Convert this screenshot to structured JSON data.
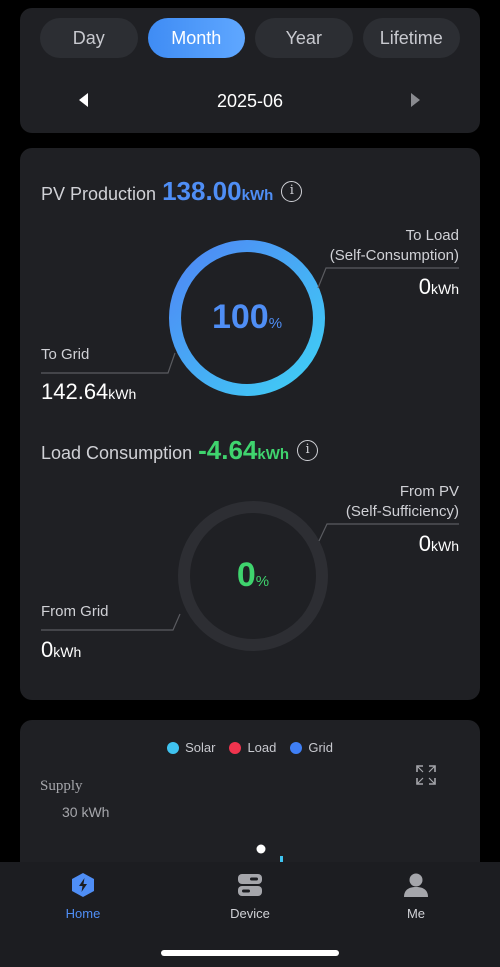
{
  "period_tabs": [
    {
      "label": "Day",
      "active": false
    },
    {
      "label": "Month",
      "active": true
    },
    {
      "label": "Year",
      "active": false
    },
    {
      "label": "Lifetime",
      "active": false
    }
  ],
  "date": {
    "label": "2025-06",
    "prev_icon": "chevron-left-icon",
    "next_icon": "chevron-right-icon"
  },
  "pv": {
    "title": "PV Production",
    "value": "138.00",
    "unit": "kWh",
    "percent": "100",
    "percent_unit": "%",
    "ring_fill": 1.0,
    "to_load_label_line1": "To Load",
    "to_load_label_line2": "(Self-Consumption)",
    "to_load_value": "0",
    "to_load_unit": "kWh",
    "to_grid_label": "To Grid",
    "to_grid_value": "142.64",
    "to_grid_unit": "kWh"
  },
  "load": {
    "title": "Load Consumption",
    "value": "-4.64",
    "unit": "kWh",
    "percent": "0",
    "percent_unit": "%",
    "ring_fill": 0.0,
    "from_pv_label_line1": "From PV",
    "from_pv_label_line2": "(Self-Sufficiency)",
    "from_pv_value": "0",
    "from_pv_unit": "kWh",
    "from_grid_label": "From Grid",
    "from_grid_value": "0",
    "from_grid_unit": "kWh"
  },
  "info_icon_glyph": "i",
  "chart": {
    "legend": [
      {
        "label": "Solar",
        "color": "#3fc3f0"
      },
      {
        "label": "Load",
        "color": "#f0344e"
      },
      {
        "label": "Grid",
        "color": "#3f7ff5"
      }
    ],
    "y_axis_label": "Supply",
    "y_tick": "30 kWh"
  },
  "nav": [
    {
      "label": "Home",
      "icon": "home-bolt-icon",
      "active": true
    },
    {
      "label": "Device",
      "icon": "device-icon",
      "active": false
    },
    {
      "label": "Me",
      "icon": "user-icon",
      "active": false
    }
  ],
  "colors": {
    "accent": "#4f8ef5",
    "green": "#3fd46e",
    "card": "#1f2024",
    "background": "#000000"
  }
}
